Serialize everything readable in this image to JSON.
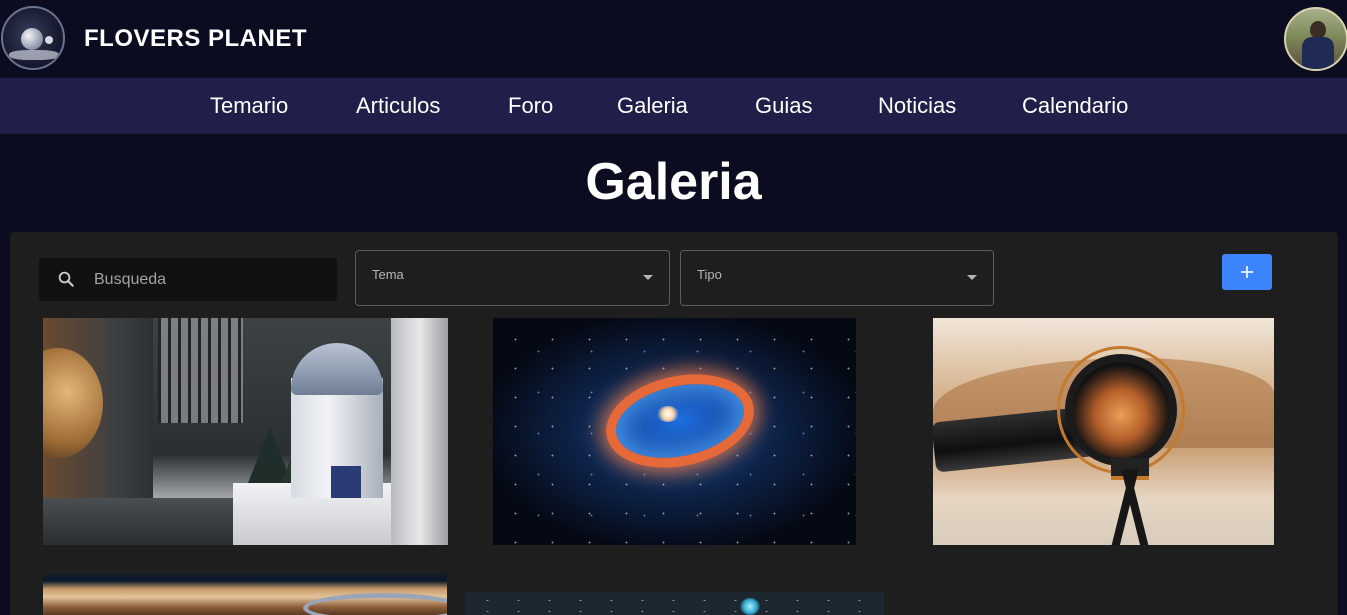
{
  "header": {
    "brand": "FLOVERS PLANET",
    "logo_icon": "planet-logo-icon",
    "avatar_icon": "user-avatar"
  },
  "nav": {
    "items": [
      "Temario",
      "Articulos",
      "Foro",
      "Galeria",
      "Guias",
      "Noticias",
      "Calendario"
    ]
  },
  "page": {
    "title": "Galeria"
  },
  "filters": {
    "search_placeholder": "Busqueda",
    "tema_label": "Tema",
    "tipo_label": "Tipo",
    "add_icon": "plus-icon"
  },
  "gallery": {
    "images": [
      "observatory-mural-image",
      "nebula-ring-image",
      "telescope-desert-image",
      "saturn-image",
      "deep-space-image"
    ]
  },
  "colors": {
    "background": "#0b0c1f",
    "navbar": "#1f1f4a",
    "panel": "#1e1e1e",
    "accent": "#3d85ff"
  }
}
